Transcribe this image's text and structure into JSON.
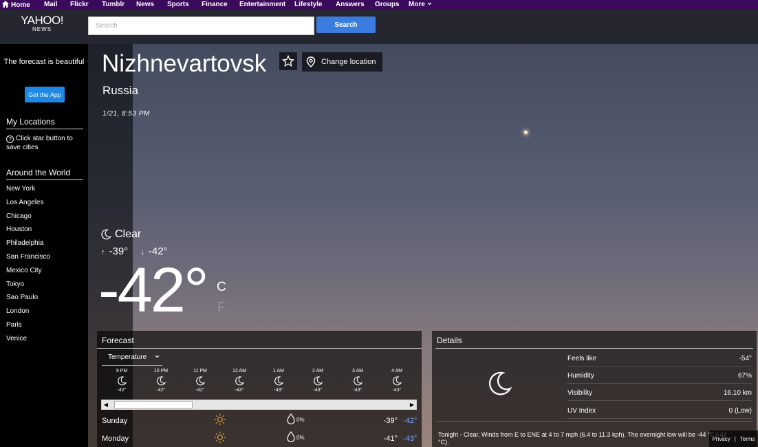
{
  "topnav": {
    "items": [
      "Home",
      "Mail",
      "Flickr",
      "Tumblr",
      "News",
      "Sports",
      "Finance",
      "Entertainment",
      "Lifestyle",
      "Answers",
      "Groups",
      "More"
    ]
  },
  "logo": {
    "line1": "YAHOO!",
    "line2": "NEWS"
  },
  "search": {
    "placeholder": "Search",
    "button": "Search"
  },
  "sidebar": {
    "promo": "The forecast is beautiful",
    "get_app": "Get the App",
    "my_locations_title": "My Locations",
    "hint": "Click star button to save cities",
    "around_title": "Around the World",
    "cities": [
      "New York",
      "Los Angeles",
      "Chicago",
      "Houston",
      "Philadelphia",
      "San Francisco",
      "Mexico City",
      "Tokyo",
      "Sao Paulo",
      "London",
      "Paris",
      "Venice"
    ]
  },
  "location": {
    "city": "Nizhnevartovsk",
    "country": "Russia",
    "datetime": "1/21, 8:53 PM",
    "change_label": "Change location"
  },
  "current": {
    "condition": "Clear",
    "high": "-39°",
    "low": "-42°",
    "temp": "-42°",
    "unit_c": "C",
    "unit_f": "F"
  },
  "forecast": {
    "title": "Forecast",
    "dropdown": "Temperature",
    "hours": [
      {
        "time": "9 PM",
        "temp": "-42°"
      },
      {
        "time": "10 PM",
        "temp": "-42°"
      },
      {
        "time": "11 PM",
        "temp": "-42°"
      },
      {
        "time": "12 AM",
        "temp": "-43°"
      },
      {
        "time": "1 AM",
        "temp": "-43°"
      },
      {
        "time": "2 AM",
        "temp": "-43°"
      },
      {
        "time": "3 AM",
        "temp": "-43°"
      },
      {
        "time": "4 AM",
        "temp": "-43°"
      }
    ],
    "days": [
      {
        "day": "Sunday",
        "precip": "0%",
        "high": "-39°",
        "low": "-42°"
      },
      {
        "day": "Monday",
        "precip": "0%",
        "high": "-41°",
        "low": "-43°"
      }
    ]
  },
  "details": {
    "title": "Details",
    "rows": [
      {
        "label": "Feels like",
        "value": "-54°"
      },
      {
        "label": "Humidity",
        "value": "67%"
      },
      {
        "label": "Visibility",
        "value": "16.10 km"
      },
      {
        "label": "UV Index",
        "value": "0 (Low)"
      }
    ],
    "tonight": "Tonight - Clear. Winds from E to ENE at 4 to 7 mph (6.4 to 11.3 kph). The overnight low will be -44 °F (-42 °C)."
  },
  "footer": {
    "privacy": "Privacy",
    "sep": "|",
    "terms": "Terms"
  },
  "colors": {
    "nav": "#3b0a5c",
    "accent": "#3a7dde",
    "low_temp": "#7fa9ff"
  }
}
